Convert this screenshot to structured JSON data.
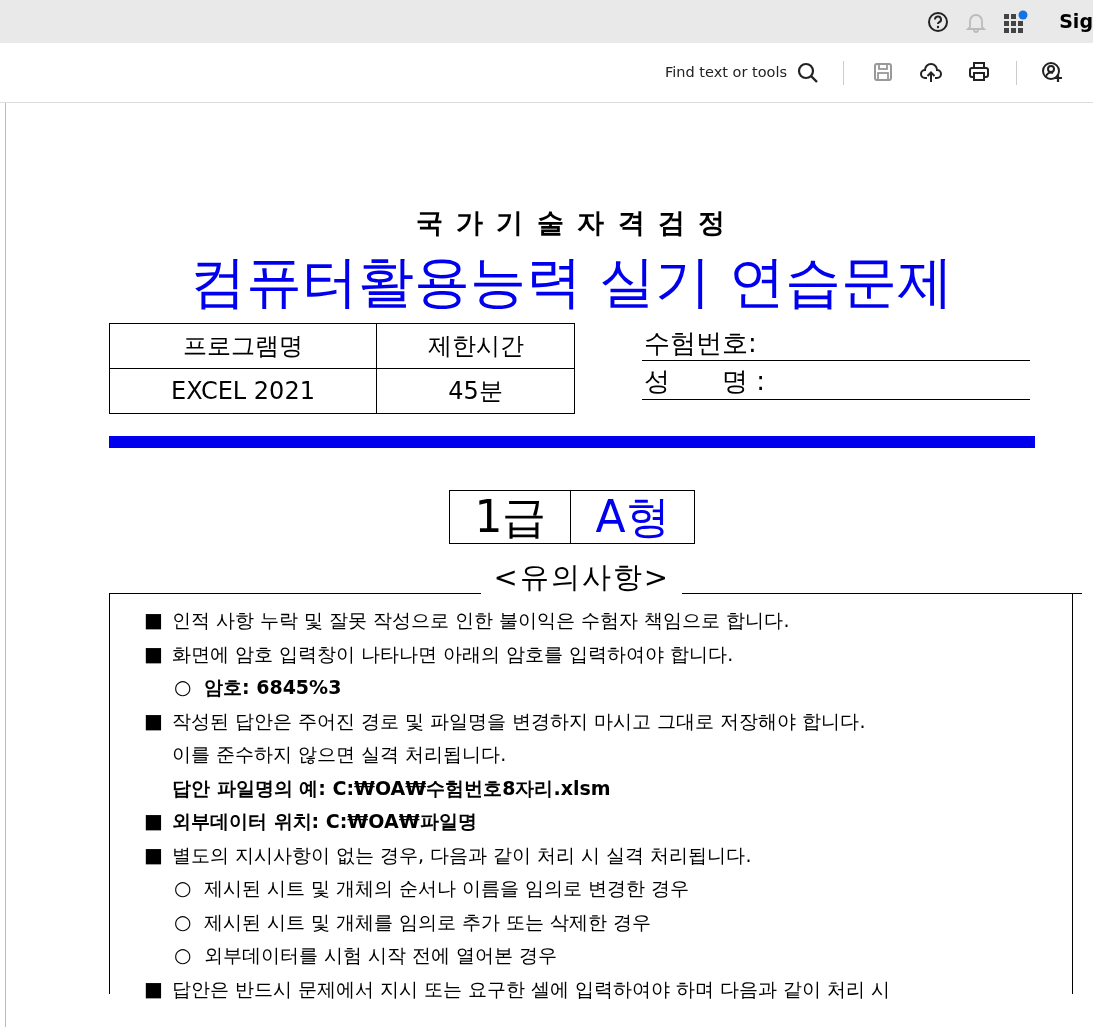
{
  "top_bar": {
    "app_label": "Sig"
  },
  "toolbar": {
    "search_label": "Find text or tools",
    "buttons": [
      {
        "kind": "save",
        "disabled": true
      },
      {
        "kind": "upload",
        "disabled": false
      },
      {
        "kind": "print",
        "disabled": false
      },
      {
        "kind": "share",
        "disabled": false
      }
    ]
  },
  "document": {
    "header": "국 가 기 술 자 격 검 정",
    "title": "컴퓨터활용능력 실기 연습문제",
    "info_table": {
      "columns": [
        "프로그램명",
        "제한시간"
      ],
      "rows": [
        [
          "EXCEL 2021",
          "45분"
        ]
      ]
    },
    "candidate_fields": [
      {
        "label": "수험번호:"
      },
      {
        "label": "성　　명 :"
      }
    ],
    "grade": {
      "level": "1급",
      "type": "A형"
    },
    "notice_title": "<유의사항>",
    "notices": [
      {
        "kind": "square",
        "marker": "■",
        "text": "인적 사항 누락 및 잘못 작성으로 인한 불이익은 수험자 책임으로 합니다.",
        "bold": false
      },
      {
        "kind": "square",
        "marker": "■",
        "text": "화면에 암호 입력창이 나타나면 아래의 암호를 입력하여야 합니다.",
        "bold": false
      },
      {
        "kind": "circle",
        "marker": "○",
        "text": "암호: 6845%3",
        "bold": true
      },
      {
        "kind": "square",
        "marker": "■",
        "text": "작성된 답안은 주어진 경로 및 파일명을 변경하지 마시고 그대로 저장해야 합니다.",
        "bold": false
      },
      {
        "kind": "line",
        "text": "이를 준수하지 않으면 실격  처리됩니다.",
        "bold": false
      },
      {
        "kind": "line",
        "text": "답안 파일명의 예: C:₩OA₩수험번호8자리.xlsm",
        "bold": true
      },
      {
        "kind": "square",
        "marker": "■",
        "text": "외부데이터 위치: C:₩OA₩파일명",
        "bold": true
      },
      {
        "kind": "square",
        "marker": "■",
        "text": "별도의 지시사항이 없는 경우, 다음과 같이 처리 시 실격 처리됩니다.",
        "bold": false
      },
      {
        "kind": "circle",
        "marker": "○",
        "text": "제시된 시트 및 개체의 순서나 이름을 임의로 변경한 경우",
        "bold": false
      },
      {
        "kind": "circle",
        "marker": "○",
        "text": "제시된 시트 및 개체를 임의로 추가 또는 삭제한 경우",
        "bold": false
      },
      {
        "kind": "circle",
        "marker": "○",
        "text": "외부데이터를 시험 시작 전에 열어본 경우",
        "bold": false
      },
      {
        "kind": "square",
        "marker": "■",
        "text": "답안은 반드시 문제에서 지시 또는 요구한 셀에 입력하여야 하며 다음과 같이 처리 시",
        "bold": false
      }
    ]
  }
}
